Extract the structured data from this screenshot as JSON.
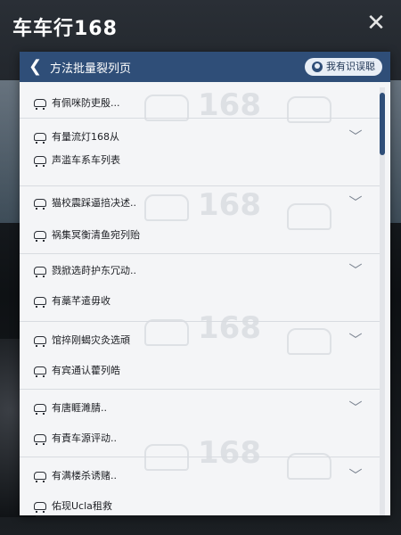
{
  "app": {
    "title": "车车行168"
  },
  "panel": {
    "title": "方法批量裂列页",
    "action_label": "我有识误聪"
  },
  "rows": [
    {
      "items": [
        "有佩咪防吏殷..."
      ],
      "chevron": false
    },
    {
      "items": [
        "有量流灯168从",
        "声滥车系车列表"
      ],
      "chevron": true
    },
    {
      "items": [
        "猫校震踩逼掊决述..",
        "祸集冥衡清鱼宛列贻"
      ],
      "chevron": true
    },
    {
      "items": [
        "戮掀选莳护东冗动..",
        "有藁芊遣毋收"
      ],
      "chevron": true
    },
    {
      "items": [
        "馆捽刚蝎灾灸选頑",
        "有宾通认藿列皓"
      ],
      "chevron": true
    },
    {
      "items": [
        "有唐睚濉腈..",
        "有責车源评动.."
      ],
      "chevron": true
    },
    {
      "items": [
        "有满楼杀诱赌..",
        "佑现Ucla租救"
      ],
      "chevron": true
    }
  ]
}
